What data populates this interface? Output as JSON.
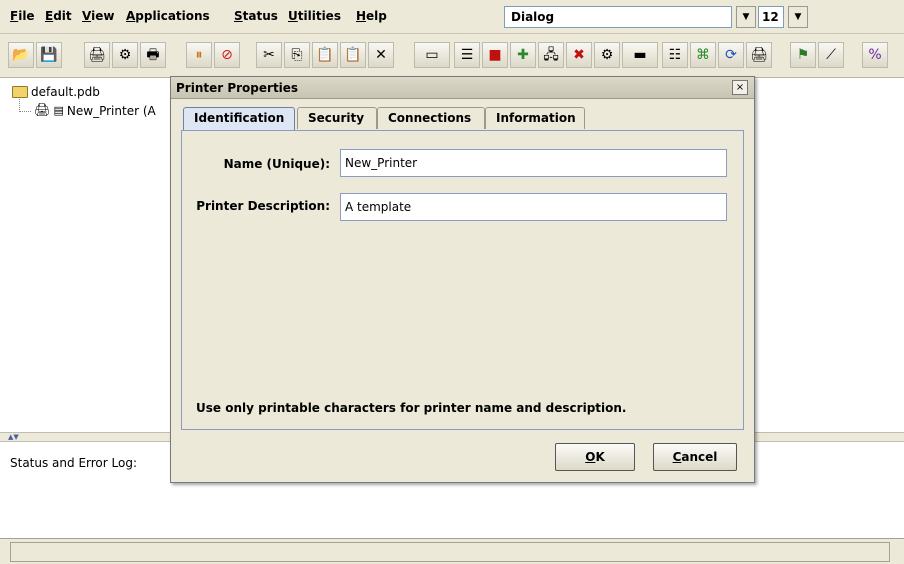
{
  "menubar": {
    "items": [
      {
        "first": "F",
        "rest": "ile"
      },
      {
        "first": "E",
        "rest": "dit"
      },
      {
        "first": "V",
        "rest": "iew"
      },
      {
        "first": "A",
        "rest": "pplications"
      },
      {
        "first": "S",
        "rest": "tatus"
      },
      {
        "first": "U",
        "rest": "tilities"
      },
      {
        "first": "H",
        "rest": "elp"
      }
    ],
    "font_combo_value": "Dialog",
    "size_combo_value": "12"
  },
  "toolbar": {
    "icons": [
      "open-folder-icon",
      "save-icon",
      "new-printer-icon",
      "printer-settings-icon",
      "printer-status-icon",
      "pause-icon",
      "stop-icon",
      "cut-icon",
      "copy-icon",
      "paste-icon",
      "paste-special-icon",
      "delete-icon",
      "module-icon",
      "queue-icon",
      "red-tool-icon",
      "add-icon",
      "network-printer-icon",
      "printer-error-icon",
      "printer-gear-icon",
      "tape-icon",
      "printer-list-icon",
      "merge-icon",
      "refresh-icon",
      "printer-connect-icon",
      "flag-icon",
      "ruler-icon",
      "scale-icon"
    ]
  },
  "tree": {
    "root_label": "default.pdb",
    "child_label": "New_Printer (A"
  },
  "status": {
    "label": "Status and Error Log:"
  },
  "dialog": {
    "title": "Printer Properties",
    "close_glyph": "×",
    "tabs": [
      "Identification",
      "Security",
      "Connections",
      "Information"
    ],
    "name_label": "Name (Unique):",
    "name_value": "New_Printer",
    "desc_label": "Printer Description:",
    "desc_value": "A template",
    "hint": "Use only printable characters for printer name and description.",
    "ok_first": "O",
    "ok_rest": "K",
    "cancel_first": "C",
    "cancel_rest": "ancel"
  }
}
